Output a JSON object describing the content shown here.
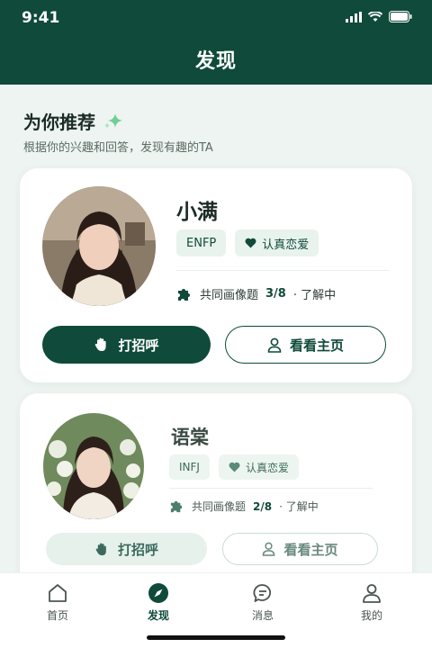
{
  "status": {
    "time": "9:41"
  },
  "nav": {
    "title": "发现"
  },
  "section": {
    "title": "为你推荐",
    "subtitle": "根据你的兴趣和回答，发现有趣的TA"
  },
  "cards": [
    {
      "name": "小满",
      "tags": [
        "ENFP",
        "认真恋爱"
      ],
      "common_label": "共同画像题",
      "common_count": "3/8",
      "common_suffix": "· 了解中",
      "hi_label": "打招呼",
      "home_label": "看看主页"
    },
    {
      "name": "语棠",
      "tags": [
        "INFJ",
        "认真恋爱"
      ],
      "common_label": "共同画像题",
      "common_count": "2/8",
      "common_suffix": "· 了解中",
      "hi_label": "打招呼",
      "home_label": "看看主页"
    }
  ],
  "tabbar": {
    "items": [
      {
        "label": "首页",
        "icon": "home-icon"
      },
      {
        "label": "发现",
        "icon": "compass-icon"
      },
      {
        "label": "消息",
        "icon": "chat-icon"
      },
      {
        "label": "我的",
        "icon": "user-icon"
      }
    ]
  },
  "colors": {
    "primary": "#0f4a3a",
    "accent": "#6fcf97",
    "background": "#eef4f1"
  }
}
